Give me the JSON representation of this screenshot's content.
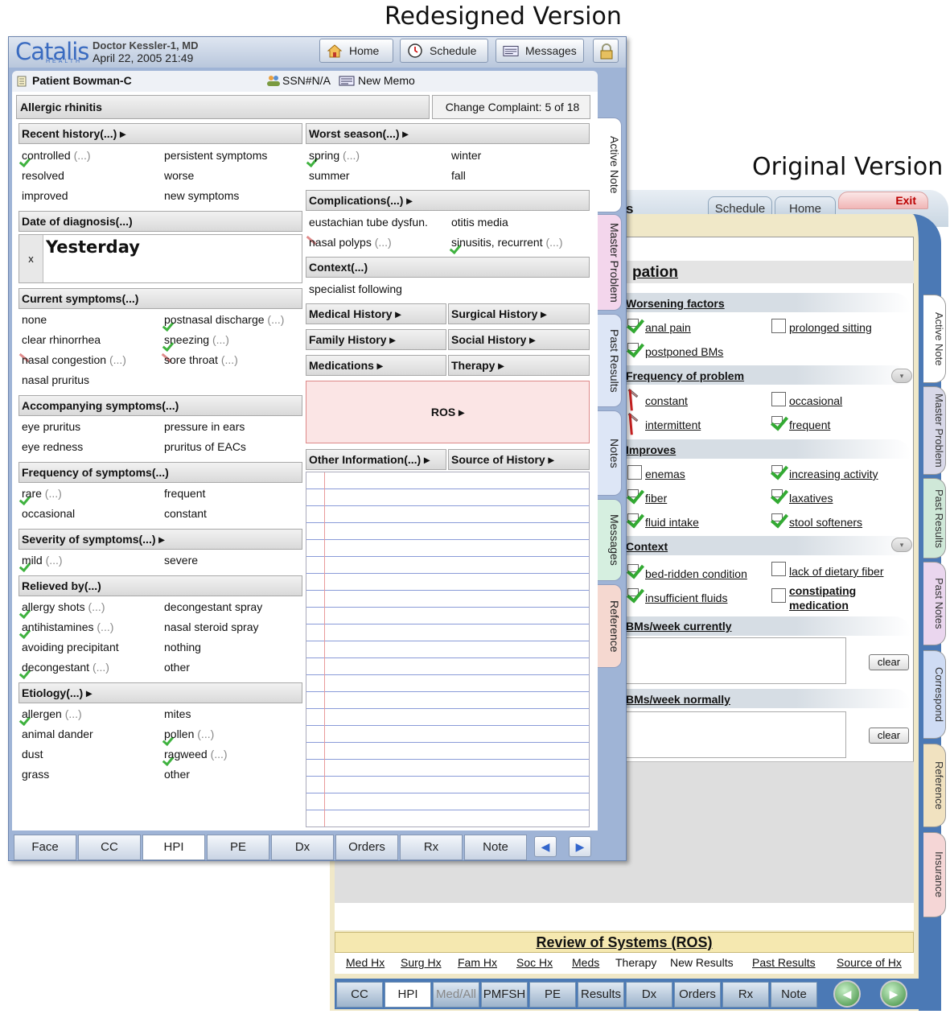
{
  "titles": {
    "redesigned": "Redesigned Version",
    "original": "Original Version"
  },
  "original": {
    "top_tabs": [
      "Schedule",
      "Home"
    ],
    "exit_label": "Exit",
    "title_fragment": "pation",
    "title_fragment_top": "s",
    "sections": {
      "worsening": "Worsening factors",
      "frequency": "Frequency of problem",
      "improves": "Improves",
      "context": "Context",
      "bms_current": "BMs/week currently",
      "bms_normal": "BMs/week normally"
    },
    "items": {
      "anal_pain": "anal pain",
      "prolonged_sitting": "prolonged sitting",
      "postponed_bms": "postponed BMs",
      "constant": "constant",
      "occasional": "occasional",
      "intermittent": "intermittent",
      "frequent": "frequent",
      "enemas": "enemas",
      "increasing_activity": "increasing activity",
      "fiber": "fiber",
      "laxatives": "laxatives",
      "fluid_intake": "fluid intake",
      "stool_softeners": "stool softeners",
      "bed_ridden": "bed-ridden condition",
      "lack_fiber": "lack of dietary fiber",
      "insufficient_fluids": "insufficient fluids",
      "constipating_1": "constipating",
      "constipating_2": "medication"
    },
    "clear_label": "clear",
    "ros_title": "Review of Systems (ROS)",
    "sub_nav": [
      "Med Hx",
      "Surg Hx",
      "Fam Hx",
      "Soc Hx",
      "Meds",
      "Therapy",
      "New Results",
      "Past Results",
      "Source of Hx"
    ],
    "bottom_tabs": [
      "CC",
      "HPI",
      "Med/All",
      "PMFSH",
      "PE",
      "Results",
      "Dx",
      "Orders",
      "Rx",
      "Note"
    ],
    "side_tabs": [
      "Active Note",
      "Master Problem",
      "Past Results",
      "Past Notes",
      "Correspond",
      "Reference",
      "Insurance"
    ]
  },
  "redesigned": {
    "logo": "Catalis",
    "logo_sub": "HEALTH",
    "doctor": "Doctor Kessler-1, MD",
    "datetime": "April 22, 2005 21:49",
    "header_buttons": {
      "home": "Home",
      "schedule": "Schedule",
      "messages": "Messages"
    },
    "patient": "Patient Bowman-C",
    "ssn": "SSN#N/A",
    "new_memo": "New Memo",
    "complaint": "Allergic rhinitis",
    "change_complaint": "Change Complaint: 5 of 18",
    "left": {
      "recent_history": "Recent history(...)  ▸",
      "rh_controlled": "controlled",
      "rh_persistent": "persistent symptoms",
      "rh_resolved": "resolved",
      "rh_worse": "worse",
      "rh_improved": "improved",
      "rh_new": "new symptoms",
      "date_diagnosis": "Date of diagnosis(...)",
      "date_x": "x",
      "date_value": "Yesterday",
      "current_symptoms": "Current symptoms(...)",
      "cs_none": "none",
      "cs_postnasal": "postnasal discharge",
      "cs_clear": "clear rhinorrhea",
      "cs_sneezing": "sneezing",
      "cs_congestion": "nasal congestion",
      "cs_sore": "sore throat",
      "cs_pruritus": "nasal pruritus",
      "accompanying": "Accompanying symptoms(...)",
      "ac_eye_pruritus": "eye pruritus",
      "ac_pressure": "pressure in ears",
      "ac_eye_redness": "eye redness",
      "ac_eacs": "pruritus of EACs",
      "frequency": "Frequency of symptoms(...)",
      "fr_rare": "rare",
      "fr_frequent": "frequent",
      "fr_occasional": "occasional",
      "fr_constant": "constant",
      "severity": "Severity of symptoms(...)  ▸",
      "sv_mild": "mild",
      "sv_severe": "severe",
      "relieved": "Relieved by(...)",
      "rl_allergy": "allergy shots",
      "rl_decongestant_spray": "decongestant spray",
      "rl_antihistamines": "antihistamines",
      "rl_nasal_steroid": "nasal steroid spray",
      "rl_avoiding": "avoiding precipitant",
      "rl_nothing": "nothing",
      "rl_decongestant": "decongestant",
      "rl_other": "other",
      "etiology": "Etiology(...)  ▸",
      "et_allergen": "allergen",
      "et_mites": "mites",
      "et_dander": "animal dander",
      "et_pollen": "pollen",
      "et_dust": "dust",
      "et_ragweed": "ragweed",
      "et_grass": "grass",
      "et_other": "other",
      "dots": "(...)"
    },
    "right": {
      "worst_season": "Worst season(...)  ▸",
      "ws_spring": "spring",
      "ws_winter": "winter",
      "ws_summer": "summer",
      "ws_fall": "fall",
      "complications": "Complications(...)  ▸",
      "cp_eustachian": "eustachian tube dysfun.",
      "cp_otitis": "otitis media",
      "cp_polyps": "nasal polyps",
      "cp_sinusitis": "sinusitis, recurrent",
      "context": "Context(...)",
      "cx_specialist": "specialist following",
      "medical_history": "Medical History  ▸",
      "surgical_history": "Surgical History  ▸",
      "family_history": "Family History  ▸",
      "social_history": "Social History  ▸",
      "medications": "Medications  ▸",
      "therapy": "Therapy  ▸",
      "ros": "ROS  ▸",
      "other_info": "Other Information(...)  ▸",
      "source_history": "Source of History  ▸"
    },
    "bottom_tabs": [
      "Face",
      "CC",
      "HPI",
      "PE",
      "Dx",
      "Orders",
      "Rx",
      "Note"
    ],
    "nav_prev": "◀",
    "nav_next": "▶",
    "side_tabs": [
      "Active Note",
      "Master Problem",
      "Past Results",
      "Notes",
      "Messages",
      "Reference"
    ],
    "colors": {
      "frame": "#9fb4d6",
      "check": "#3fb23f",
      "ros_bg": "#fbe5e5"
    }
  }
}
